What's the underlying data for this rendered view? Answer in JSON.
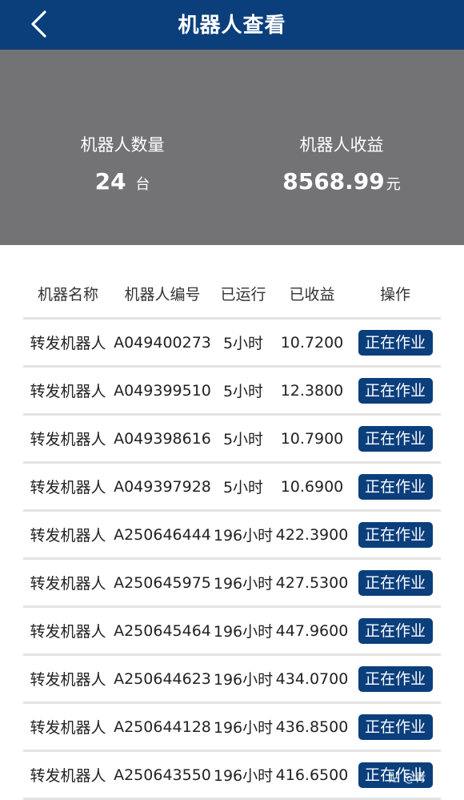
{
  "header": {
    "title": "机器人查看"
  },
  "summary": {
    "count_label": "机器人数量",
    "count_value": "24",
    "count_unit": "台",
    "income_label": "机器人收益",
    "income_value": "8568.99",
    "income_unit": "元"
  },
  "table": {
    "headers": [
      "机器名称",
      "机器人编号",
      "已运行",
      "已收益",
      "操作"
    ],
    "rows": [
      {
        "name": "转发机器人",
        "id": "A049400273",
        "run": "5小时",
        "income": "10.7200",
        "action": "正在作业"
      },
      {
        "name": "转发机器人",
        "id": "A049399510",
        "run": "5小时",
        "income": "12.3800",
        "action": "正在作业"
      },
      {
        "name": "转发机器人",
        "id": "A049398616",
        "run": "5小时",
        "income": "10.7900",
        "action": "正在作业"
      },
      {
        "name": "转发机器人",
        "id": "A049397928",
        "run": "5小时",
        "income": "10.6900",
        "action": "正在作业"
      },
      {
        "name": "转发机器人",
        "id": "A250646444",
        "run": "196小时",
        "income": "422.3900",
        "action": "正在作业"
      },
      {
        "name": "转发机器人",
        "id": "A250645975",
        "run": "196小时",
        "income": "427.5300",
        "action": "正在作业"
      },
      {
        "name": "转发机器人",
        "id": "A250645464",
        "run": "196小时",
        "income": "447.9600",
        "action": "正在作业"
      },
      {
        "name": "转发机器人",
        "id": "A250644623",
        "run": "196小时",
        "income": "434.0700",
        "action": "正在作业"
      },
      {
        "name": "转发机器人",
        "id": "A250644128",
        "run": "196小时",
        "income": "436.8500",
        "action": "正在作业"
      },
      {
        "name": "转发机器人",
        "id": "A250643550",
        "run": "196小时",
        "income": "416.6500",
        "action": "正在作业"
      }
    ]
  },
  "watermark": "贴 @青",
  "colors": {
    "primary": "#0b3f7c",
    "summary_bg": "#737275"
  }
}
